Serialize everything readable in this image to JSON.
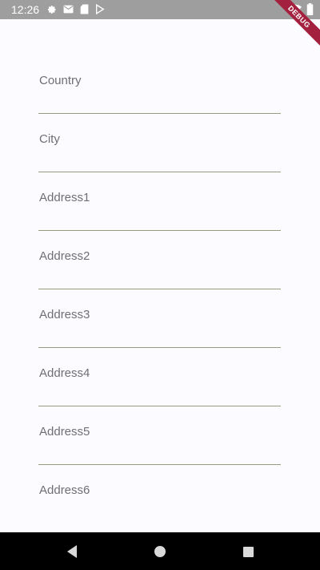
{
  "status_bar": {
    "time": "12:26",
    "left_icons": [
      "gear-icon",
      "mail-icon",
      "sd-card-icon",
      "play-store-icon"
    ],
    "right_icons": [
      "wifi-icon",
      "battery-icon"
    ]
  },
  "debug_banner": {
    "label": "DEBUG",
    "color": "#a3213f"
  },
  "form": {
    "fields": [
      {
        "label": "Country"
      },
      {
        "label": "City"
      },
      {
        "label": "Address1"
      },
      {
        "label": "Address2"
      },
      {
        "label": "Address3"
      },
      {
        "label": "Address4"
      },
      {
        "label": "Address5"
      },
      {
        "label": "Address6"
      }
    ]
  },
  "nav_bar": {
    "buttons": [
      "back-icon",
      "home-icon",
      "recents-icon"
    ]
  },
  "colors": {
    "background": "#fcfbff",
    "status_bar": "#9e9e9e",
    "label": "#6f6f74",
    "underline": "#9a9b80",
    "nav_bar": "#000000"
  }
}
